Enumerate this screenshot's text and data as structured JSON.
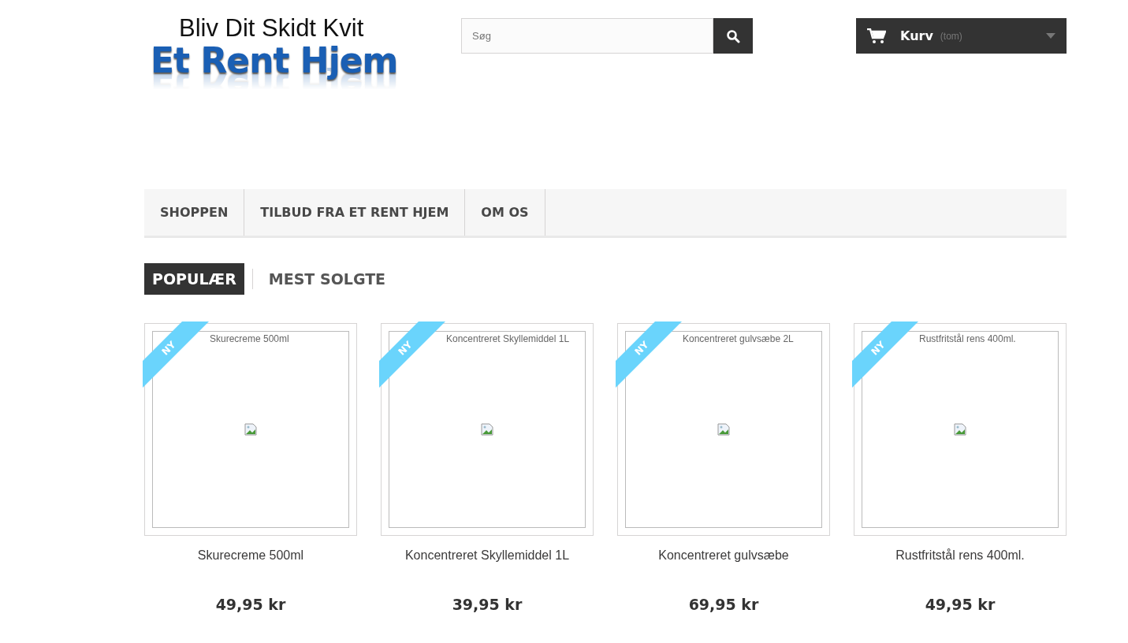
{
  "logo": {
    "tagline": "Bliv Dit Skidt Kvit",
    "name": "Et Rent Hjem"
  },
  "search": {
    "placeholder": "Søg"
  },
  "cart": {
    "label": "Kurv",
    "status": "(tom)"
  },
  "menu": [
    {
      "label": "SHOPPEN"
    },
    {
      "label": "TILBUD FRA ET RENT HJEM"
    },
    {
      "label": "OM OS"
    }
  ],
  "tabs": [
    {
      "label": "POPULÆR",
      "selected": true
    },
    {
      "label": "MEST SOLGTE",
      "selected": false
    }
  ],
  "products": [
    {
      "badge": "NY",
      "alt": "Skurecreme 500ml",
      "name": "Skurecreme 500ml",
      "price": "49,95 kr"
    },
    {
      "badge": "NY",
      "alt": "Koncentreret Skyllemiddel 1L",
      "name": "Koncentreret Skyllemiddel 1L",
      "price": "39,95 kr"
    },
    {
      "badge": "NY",
      "alt": "Koncentreret gulvsæbe 2L",
      "name": "Koncentreret gulvsæbe",
      "price": "69,95 kr"
    },
    {
      "badge": "NY",
      "alt": "Rustfritstål rens 400ml.",
      "name": "Rustfritstål rens 400ml.",
      "price": "49,95 kr"
    }
  ]
}
